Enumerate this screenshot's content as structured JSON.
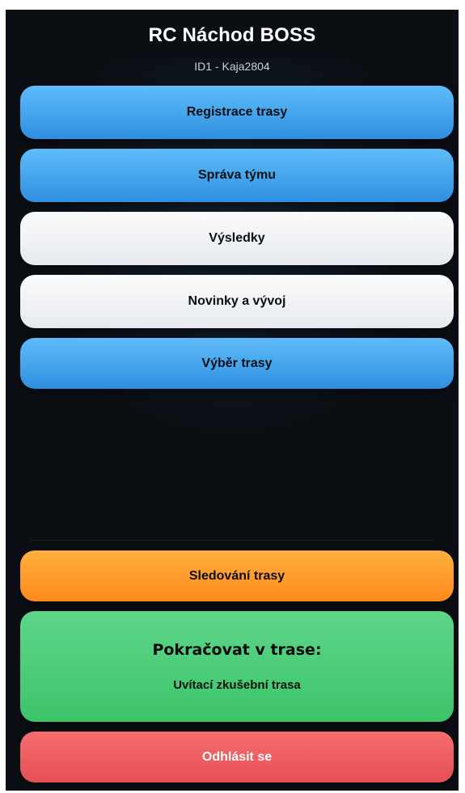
{
  "header": {
    "title": "RC Náchod BOSS",
    "user": "ID1 - Kaja2804"
  },
  "menu": {
    "items": [
      {
        "label": "Registrace trasy",
        "style": "blue"
      },
      {
        "label": "Správa týmu",
        "style": "blue"
      },
      {
        "label": "Výsledky",
        "style": "white"
      },
      {
        "label": "Novinky a vývoj",
        "style": "white"
      },
      {
        "label": "Výběr trasy",
        "style": "blue"
      }
    ]
  },
  "actions": {
    "track_label": "Sledování trasy",
    "continue_title": "Pokračovat v trase:",
    "continue_route": "Uvítací zkušební trasa",
    "logout_label": "Odhlásit se"
  },
  "colors": {
    "background": "#0b0f14",
    "blue": "#3a9ded",
    "white": "#f0f2f4",
    "orange": "#ff9a2a",
    "green": "#4dcd78",
    "red": "#ee5e62"
  }
}
